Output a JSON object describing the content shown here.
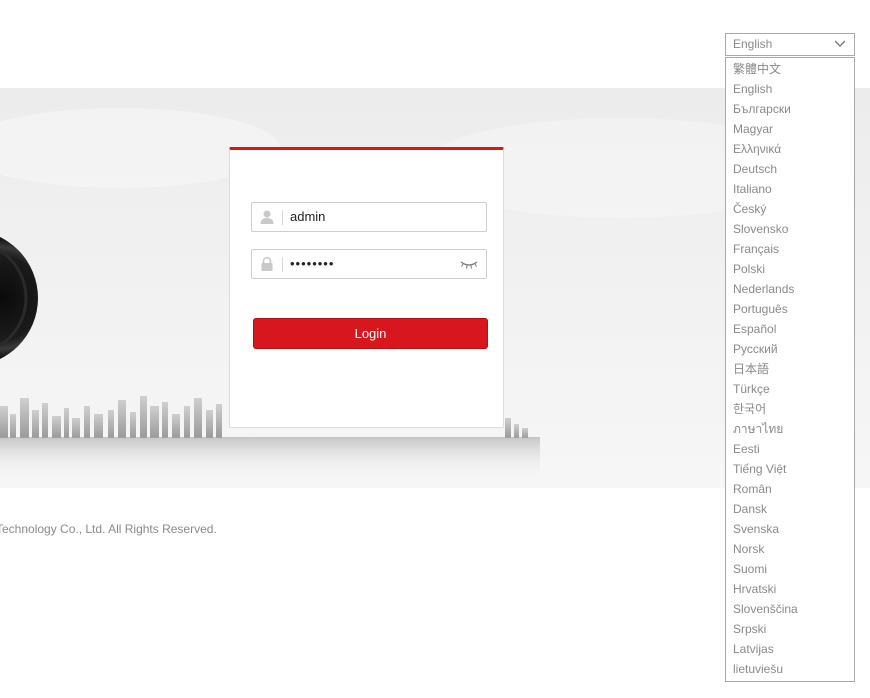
{
  "language_selector": {
    "current": "English",
    "options": [
      "繁體中文",
      "English",
      "Български",
      "Magyar",
      "Ελληνικά",
      "Deutsch",
      "Italiano",
      "Český",
      "Slovensko",
      "Français",
      "Polski",
      "Nederlands",
      "Português",
      "Español",
      "Русский",
      "日本語",
      "Türkçe",
      "한국어",
      "ภาษาไทย",
      "Eesti",
      "Tiếng Việt",
      "Român",
      "Dansk",
      "Svenska",
      "Norsk",
      "Suomi",
      "Hrvatski",
      "Slovenščina",
      "Srpski",
      "Latvijas",
      "lietuviešu"
    ]
  },
  "login": {
    "username": "admin",
    "password_mask": "••••••••",
    "button_label": "Login"
  },
  "footer": {
    "copyright": "Technology Co., Ltd. All Rights Reserved."
  },
  "icons": {
    "username": "user-icon",
    "password": "lock-icon",
    "reveal": "eye-icon",
    "dropdown": "chevron-down-icon"
  },
  "colors": {
    "accent": "#d7161d",
    "text_muted": "#8a8a8a"
  }
}
